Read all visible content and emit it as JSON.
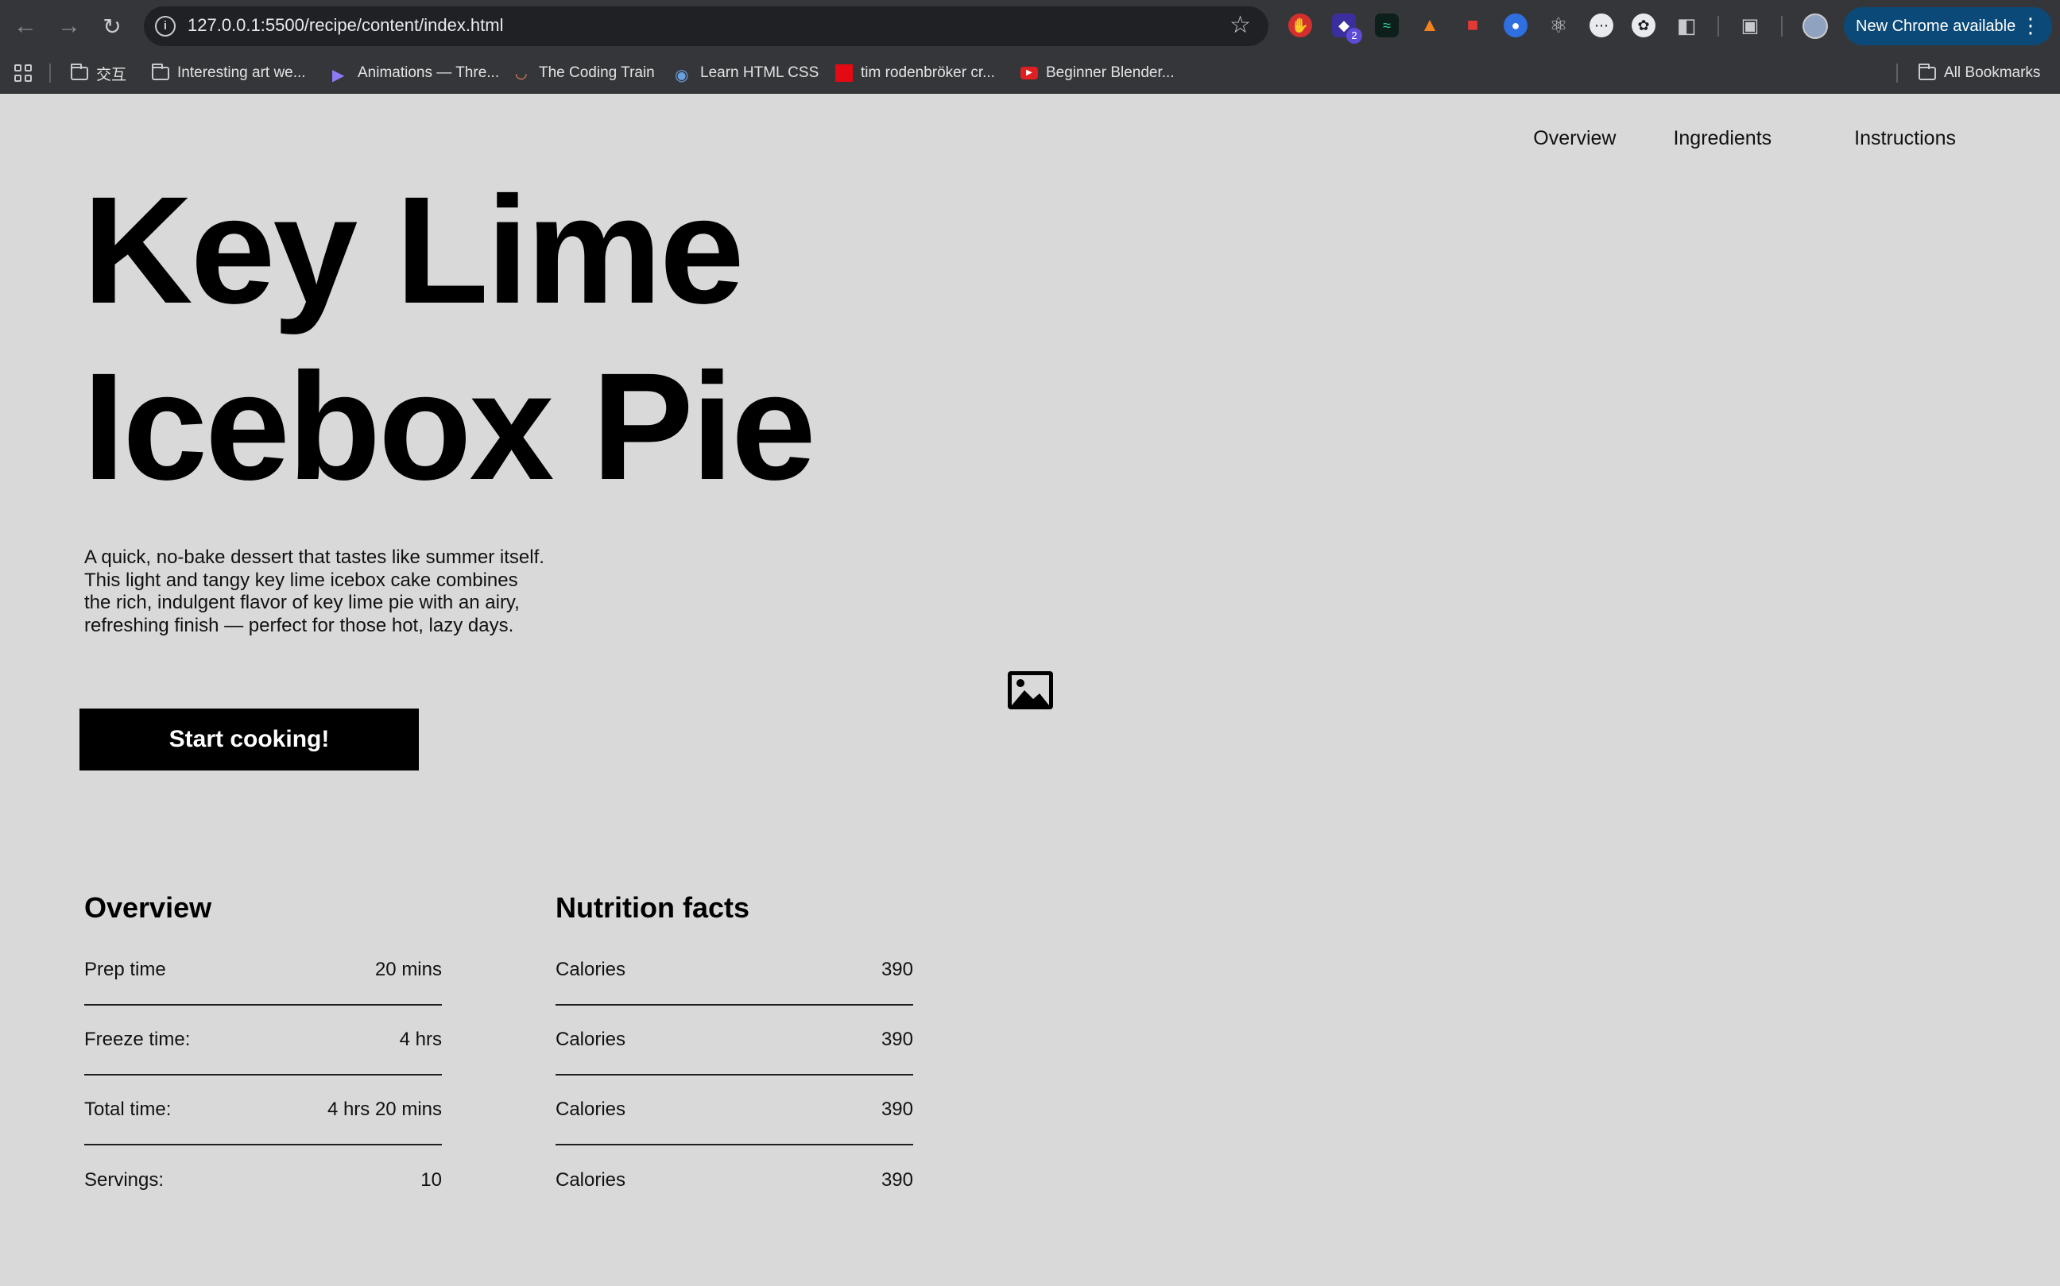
{
  "browser": {
    "url": "127.0.0.1:5500/recipe/content/index.html",
    "extension_badge": "2",
    "update_label": "New Chrome available",
    "bookmarks": [
      {
        "label": "交互",
        "icon": "folder-icon"
      },
      {
        "label": "Interesting art we...",
        "icon": "folder-icon"
      },
      {
        "label": "Animations — Thre...",
        "icon": "threejs-icon"
      },
      {
        "label": "The Coding Train",
        "icon": "rainbow-icon"
      },
      {
        "label": "Learn HTML CSS",
        "icon": "globe-icon"
      },
      {
        "label": "tim rodenbröker cr...",
        "icon": "red-square-icon"
      },
      {
        "label": "Beginner Blender...",
        "icon": "youtube-icon"
      }
    ],
    "all_bookmarks_label": "All Bookmarks"
  },
  "nav": {
    "overview": "Overview",
    "ingredients": "Ingredients",
    "instructions": "Instructions"
  },
  "hero": {
    "title_line1": "Key Lime",
    "title_line2": "Icebox Pie",
    "description": "A quick, no-bake dessert that tastes like summer itself. This light and tangy key lime icebox cake combines the rich, indulgent flavor of key lime pie with an airy, refreshing finish — perfect for those hot, lazy days.",
    "cta_label": "Start cooking!",
    "image_icon": "image-icon"
  },
  "overview": {
    "title": "Overview",
    "rows": [
      {
        "label": "Prep time",
        "value": "20 mins"
      },
      {
        "label": "Freeze time:",
        "value": "4 hrs"
      },
      {
        "label": "Total time:",
        "value": "4 hrs 20 mins"
      },
      {
        "label": "Servings:",
        "value": "10"
      }
    ]
  },
  "nutrition": {
    "title": "Nutrition facts",
    "rows": [
      {
        "label": "Calories",
        "value": "390"
      },
      {
        "label": "Calories",
        "value": "390"
      },
      {
        "label": "Calories",
        "value": "390"
      },
      {
        "label": "Calories",
        "value": "390"
      }
    ]
  },
  "colors": {
    "page_background": "#d9d9d9",
    "button_background": "#000000",
    "button_text": "#ffffff",
    "chrome_toolbar": "#35363a",
    "update_button": "#0b4a78"
  }
}
